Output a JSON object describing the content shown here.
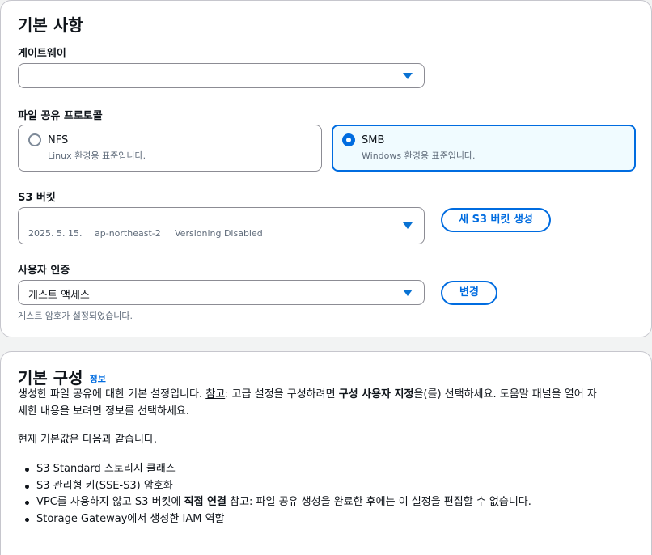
{
  "basics": {
    "title": "기본 사항",
    "gateway": {
      "label": "게이트웨이",
      "value": ""
    },
    "protocol": {
      "label": "파일 공유 프로토콜",
      "options": [
        {
          "title": "NFS",
          "desc": "Linux 환경용 표준입니다.",
          "selected": false
        },
        {
          "title": "SMB",
          "desc": "Windows 환경용 표준입니다.",
          "selected": true
        }
      ]
    },
    "bucket": {
      "label": "S3 버킷",
      "value": "",
      "date": "2025. 5. 15.",
      "region": "ap-northeast-2",
      "versioning": "Versioning Disabled",
      "create_button": "새 S3 버킷 생성"
    },
    "auth": {
      "label": "사용자 인증",
      "value": "게스트 액세스",
      "change_button": "변경",
      "hint": "게스트 암호가 설정되었습니다."
    }
  },
  "config": {
    "title": "기본 구성",
    "info": "정보",
    "desc_part1": "생성한 파일 공유에 대한 기본 설정입니다. ",
    "desc_note": "참고",
    "desc_part2": ": 고급 설정을 구성하려면 ",
    "desc_bold": "구성 사용자 지정",
    "desc_part3": "을(를) 선택하세요. 도움말 패널을 열어 자",
    "desc_line2": "세한 내용을 보려면 정보를 선택하세요.",
    "defaults_intro": "현재 기본값은 다음과 같습니다.",
    "items": [
      "S3 Standard 스토리지 클래스",
      "S3 관리형 키(SSE-S3) 암호화",
      "Storage Gateway에서 생성한 IAM 역할"
    ],
    "vpc_item": {
      "part1": "VPC를 사용하지 않고 S3 버킷에 ",
      "bold": "직접 연결",
      "part2": " 참고: 파일 공유 생성을 완료한 후에는 이 설정을 편집할 수 없습니다."
    }
  }
}
